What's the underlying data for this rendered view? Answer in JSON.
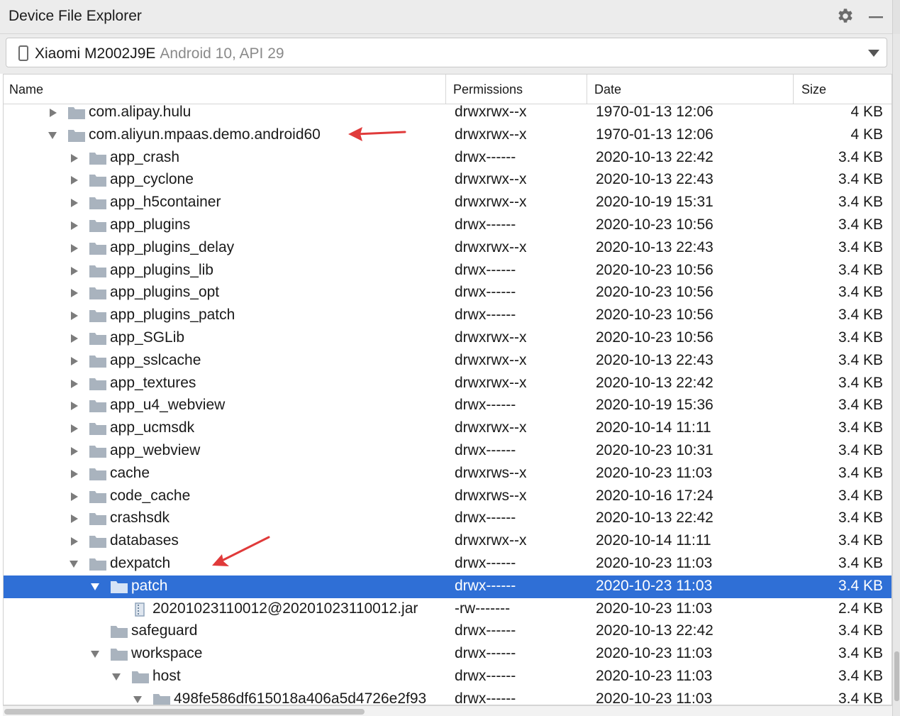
{
  "panel": {
    "title": "Device File Explorer"
  },
  "device": {
    "name": "Xiaomi M2002J9E",
    "api": "Android 10, API 29"
  },
  "columns": {
    "name": "Name",
    "permissions": "Permissions",
    "date": "Date",
    "size": "Size"
  },
  "rows": [
    {
      "name": "com.alipay.hulu",
      "perm": "drwxrwx--x",
      "date": "1970-01-13 12:06",
      "size": "4 KB",
      "depth": 0,
      "toggle": "collapsed",
      "kind": "folder"
    },
    {
      "name": "com.aliyun.mpaas.demo.android60",
      "perm": "drwxrwx--x",
      "date": "1970-01-13 12:06",
      "size": "4 KB",
      "depth": 0,
      "toggle": "expanded",
      "kind": "folder"
    },
    {
      "name": "app_crash",
      "perm": "drwx------",
      "date": "2020-10-13 22:42",
      "size": "3.4 KB",
      "depth": 1,
      "toggle": "collapsed",
      "kind": "folder"
    },
    {
      "name": "app_cyclone",
      "perm": "drwxrwx--x",
      "date": "2020-10-13 22:43",
      "size": "3.4 KB",
      "depth": 1,
      "toggle": "collapsed",
      "kind": "folder"
    },
    {
      "name": "app_h5container",
      "perm": "drwxrwx--x",
      "date": "2020-10-19 15:31",
      "size": "3.4 KB",
      "depth": 1,
      "toggle": "collapsed",
      "kind": "folder"
    },
    {
      "name": "app_plugins",
      "perm": "drwx------",
      "date": "2020-10-23 10:56",
      "size": "3.4 KB",
      "depth": 1,
      "toggle": "collapsed",
      "kind": "folder"
    },
    {
      "name": "app_plugins_delay",
      "perm": "drwxrwx--x",
      "date": "2020-10-13 22:43",
      "size": "3.4 KB",
      "depth": 1,
      "toggle": "collapsed",
      "kind": "folder"
    },
    {
      "name": "app_plugins_lib",
      "perm": "drwx------",
      "date": "2020-10-23 10:56",
      "size": "3.4 KB",
      "depth": 1,
      "toggle": "collapsed",
      "kind": "folder"
    },
    {
      "name": "app_plugins_opt",
      "perm": "drwx------",
      "date": "2020-10-23 10:56",
      "size": "3.4 KB",
      "depth": 1,
      "toggle": "collapsed",
      "kind": "folder"
    },
    {
      "name": "app_plugins_patch",
      "perm": "drwx------",
      "date": "2020-10-23 10:56",
      "size": "3.4 KB",
      "depth": 1,
      "toggle": "collapsed",
      "kind": "folder"
    },
    {
      "name": "app_SGLib",
      "perm": "drwxrwx--x",
      "date": "2020-10-23 10:56",
      "size": "3.4 KB",
      "depth": 1,
      "toggle": "collapsed",
      "kind": "folder"
    },
    {
      "name": "app_sslcache",
      "perm": "drwxrwx--x",
      "date": "2020-10-13 22:43",
      "size": "3.4 KB",
      "depth": 1,
      "toggle": "collapsed",
      "kind": "folder"
    },
    {
      "name": "app_textures",
      "perm": "drwxrwx--x",
      "date": "2020-10-13 22:42",
      "size": "3.4 KB",
      "depth": 1,
      "toggle": "collapsed",
      "kind": "folder"
    },
    {
      "name": "app_u4_webview",
      "perm": "drwx------",
      "date": "2020-10-19 15:36",
      "size": "3.4 KB",
      "depth": 1,
      "toggle": "collapsed",
      "kind": "folder"
    },
    {
      "name": "app_ucmsdk",
      "perm": "drwxrwx--x",
      "date": "2020-10-14 11:11",
      "size": "3.4 KB",
      "depth": 1,
      "toggle": "collapsed",
      "kind": "folder"
    },
    {
      "name": "app_webview",
      "perm": "drwx------",
      "date": "2020-10-23 10:31",
      "size": "3.4 KB",
      "depth": 1,
      "toggle": "collapsed",
      "kind": "folder"
    },
    {
      "name": "cache",
      "perm": "drwxrws--x",
      "date": "2020-10-23 11:03",
      "size": "3.4 KB",
      "depth": 1,
      "toggle": "collapsed",
      "kind": "folder"
    },
    {
      "name": "code_cache",
      "perm": "drwxrws--x",
      "date": "2020-10-16 17:24",
      "size": "3.4 KB",
      "depth": 1,
      "toggle": "collapsed",
      "kind": "folder"
    },
    {
      "name": "crashsdk",
      "perm": "drwx------",
      "date": "2020-10-13 22:42",
      "size": "3.4 KB",
      "depth": 1,
      "toggle": "collapsed",
      "kind": "folder"
    },
    {
      "name": "databases",
      "perm": "drwxrwx--x",
      "date": "2020-10-14 11:11",
      "size": "3.4 KB",
      "depth": 1,
      "toggle": "collapsed",
      "kind": "folder"
    },
    {
      "name": "dexpatch",
      "perm": "drwx------",
      "date": "2020-10-23 11:03",
      "size": "3.4 KB",
      "depth": 1,
      "toggle": "expanded",
      "kind": "folder"
    },
    {
      "name": "patch",
      "perm": "drwx------",
      "date": "2020-10-23 11:03",
      "size": "3.4 KB",
      "depth": 2,
      "toggle": "expanded",
      "kind": "folder",
      "selected": true
    },
    {
      "name": "20201023110012@20201023110012.jar",
      "perm": "-rw-------",
      "date": "2020-10-23 11:03",
      "size": "2.4 KB",
      "depth": 3,
      "toggle": "none",
      "kind": "file"
    },
    {
      "name": "safeguard",
      "perm": "drwx------",
      "date": "2020-10-13 22:42",
      "size": "3.4 KB",
      "depth": 2,
      "toggle": "none",
      "kind": "folder"
    },
    {
      "name": "workspace",
      "perm": "drwx------",
      "date": "2020-10-23 11:03",
      "size": "3.4 KB",
      "depth": 2,
      "toggle": "expanded",
      "kind": "folder"
    },
    {
      "name": "host",
      "perm": "drwx------",
      "date": "2020-10-23 11:03",
      "size": "3.4 KB",
      "depth": 3,
      "toggle": "expanded",
      "kind": "folder"
    },
    {
      "name": "498fe586df615018a406a5d4726e2f93",
      "perm": "drwx------",
      "date": "2020-10-23 11:03",
      "size": "3.4 KB",
      "depth": 4,
      "toggle": "expanded",
      "kind": "folder"
    }
  ],
  "colors": {
    "selection": "#2f6fd6",
    "folder": "#a9b3be",
    "annotation_arrow": "#e03a3a"
  },
  "icons": {
    "settings": "gear-icon",
    "hide": "minimize-icon",
    "device": "phone-icon",
    "dropdown": "chevron-down-icon"
  }
}
